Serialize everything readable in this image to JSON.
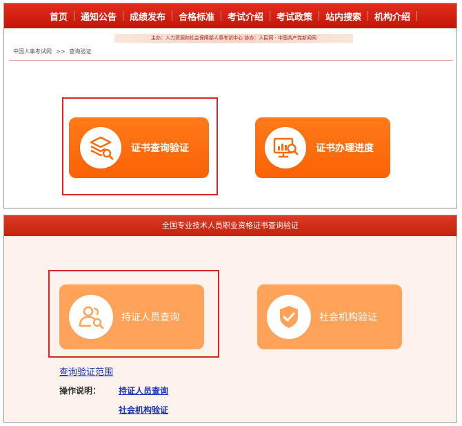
{
  "nav": {
    "items": [
      "首页",
      "通知公告",
      "成绩发布",
      "合格标准",
      "考试介绍",
      "考试政策",
      "站内搜索",
      "机构介绍"
    ]
  },
  "sponsor_text": "主办：人力资源和社会保障部人事考试中心    协办：人民网 · 中国共产党新闻网",
  "breadcrumb": {
    "home": "中国人事考试网",
    "separator": ">>",
    "current": "查询验证"
  },
  "top_buttons": {
    "cert_verify": "证书查询验证",
    "cert_progress": "证书办理进度"
  },
  "bottom": {
    "title": "全国专业技术人员职业资格证书查询验证",
    "holder_query": "持证人员查询",
    "org_verify": "社会机构验证",
    "scope_link": "查询验证范围",
    "instructions_label": "操作说明：",
    "instr_holder_link": "持证人员查询",
    "instr_org_link": "社会机构验证"
  },
  "colors": {
    "nav_red": "#d51f10",
    "orange": "#fa6a0c",
    "light_orange": "#ffa35a",
    "highlight_red": "#d8252a",
    "link_blue": "#1a35b5"
  }
}
